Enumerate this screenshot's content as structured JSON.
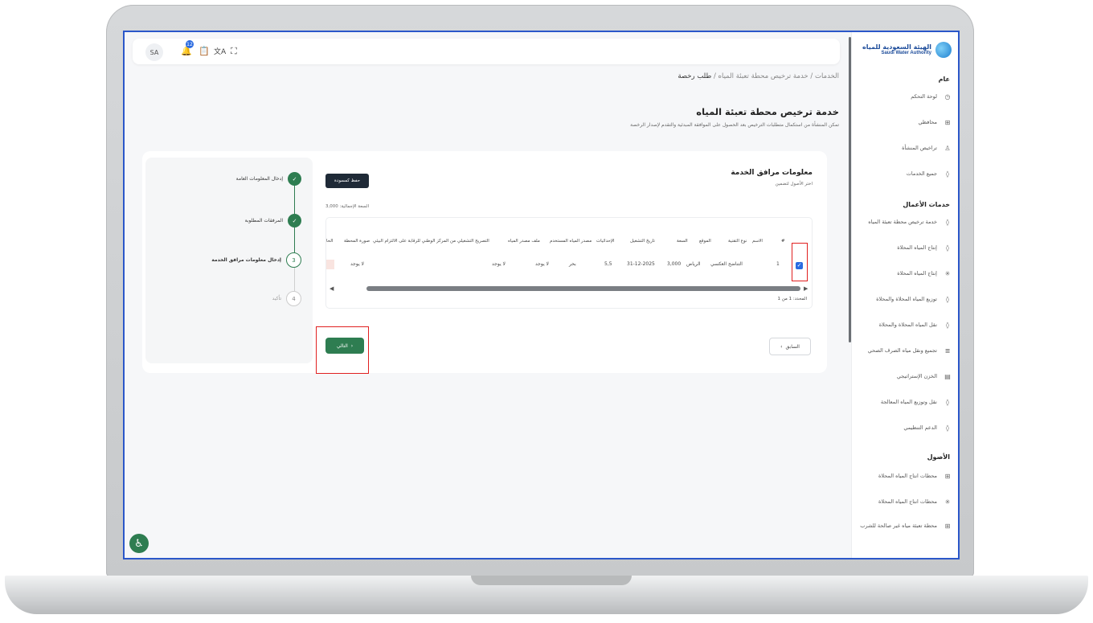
{
  "topbar": {
    "avatar": "SA",
    "notif_count": "12"
  },
  "sidebar": {
    "logo_ar": "الهيئة السعودية للمياه",
    "logo_en": "Saudi Water Authority",
    "section_general": "عام",
    "general_items": [
      {
        "label": "لوحة التحكم",
        "icon": "dashboard-icon"
      },
      {
        "label": "محافظي",
        "icon": "grid-icon"
      },
      {
        "label": "تراخيص المنشأة",
        "icon": "user-icon"
      },
      {
        "label": "جميع الخدمات",
        "icon": "drop-icon"
      }
    ],
    "section_business": "خدمات الأعمال",
    "business_items": [
      {
        "label": "خدمة ترخيص محطة تعبئة المياه",
        "icon": "drop-icon"
      },
      {
        "label": "إنتاج المياه المحلاة",
        "icon": "drop-icon"
      },
      {
        "label": "إنتاج المياه المحلاة",
        "icon": "sun-icon"
      },
      {
        "label": "توزيع المياه المحلاة والمحلاة",
        "icon": "drop-icon"
      },
      {
        "label": "نقل المياه المحلاة والمحلاة",
        "icon": "drop-icon"
      },
      {
        "label": "تجميع ونقل مياه الصرف الصحي",
        "icon": "pipes-icon"
      },
      {
        "label": "الخزن الإستراتيجي",
        "icon": "storage-icon"
      },
      {
        "label": "نقل وتوزيع المياه المعالجة",
        "icon": "drop-icon"
      },
      {
        "label": "الدعم التنظيمي",
        "icon": "drop-icon"
      }
    ],
    "section_assets": "الأصول",
    "asset_items": [
      {
        "label": "محطات انتاج المياه المحلاة",
        "icon": "grid-icon"
      },
      {
        "label": "محطات انتاج المياه المحلاة",
        "icon": "sun-icon"
      },
      {
        "label": "محطة تعبئة مياه غير صالحة للشرب",
        "icon": "grid-icon"
      }
    ]
  },
  "breadcrumb": {
    "root": "الخدمات",
    "service": "خدمة ترخيص محطة تعبئة المياه",
    "current": "طلب رخصة",
    "sep": "/"
  },
  "page": {
    "title": "خدمة ترخيص محطة تعبئة المياه",
    "subtitle": "تمكن المنشأة من استكمال متطلبات الترخيص بعد الحصول على الموافقة المبدئية والتقدم لإصدار الرخصة"
  },
  "steps": [
    {
      "num": "✓",
      "label": "إدخال المعلومات العامة",
      "state": "done"
    },
    {
      "num": "✓",
      "label": "المرفقات المطلوبة",
      "state": "done"
    },
    {
      "num": "3",
      "label": "إدخال معلومات مرافق الخدمة",
      "state": "current"
    },
    {
      "num": "4",
      "label": "تأكيد",
      "state": "next"
    }
  ],
  "section": {
    "title": "معلومات مرافق الخدمة",
    "subtitle": "اختر الأصول لتضمين",
    "draft_button": "حفظ كمسودة",
    "total_capacity": "السعة الإجمالية: 3,000"
  },
  "table": {
    "headers": [
      "#",
      "الاسم",
      "نوع التقنية",
      "الموقع",
      "السعة",
      "تاريخ التشغيل",
      "الإحداثيات",
      "مصدر المياه المستخدم",
      "ملف مصدر المياه",
      "التصريح التشغيلي من المركز الوطني للرقابة على الالتزام البيئي",
      "صورة المحطة",
      "الحا"
    ],
    "row": [
      "1",
      "",
      "التناضح العكسي",
      "الرياض",
      "3,000",
      "31-12-2025",
      "5,5",
      "بحر",
      "لا يوجد",
      "لا يوجد",
      "لا يوجد",
      ""
    ],
    "count": "المحدد: 1 من 1"
  },
  "buttons": {
    "next": "التالي",
    "prev": "السابق"
  },
  "colors": {
    "primary_green": "#2e7d51",
    "dark_button": "#1f2a37",
    "highlight_red": "#e02020",
    "accent_blue": "#2b6be0"
  }
}
